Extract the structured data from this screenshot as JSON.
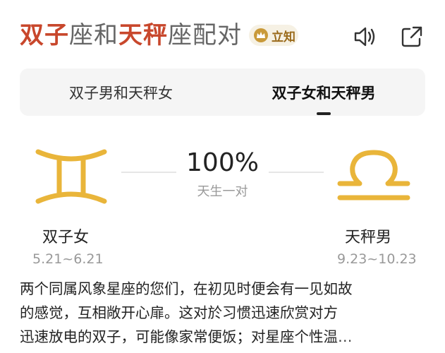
{
  "header": {
    "title": {
      "sign1": "双子",
      "connector1": "座和",
      "sign2": "天秤",
      "suffix": "座配对"
    },
    "badge_label": "立知",
    "speaker_icon": "speaker-icon",
    "share_icon": "share-icon"
  },
  "tabs": [
    {
      "label": "双子男和天秤女",
      "selected": false
    },
    {
      "label": "双子女和天秤男",
      "selected": true
    }
  ],
  "match": {
    "percent": "100%",
    "label": "天生一对",
    "left": {
      "name": "双子女",
      "dates": "5.21~6.21",
      "icon": "gemini-icon"
    },
    "right": {
      "name": "天秤男",
      "dates": "9.23~10.23",
      "icon": "libra-icon"
    }
  },
  "description": {
    "lines": [
      "两个同属风象星座的您们，在初见时便会有一见如故",
      "的感觉，互相敞开心扉。这对於习惯迅速欣赏对方",
      "迅速放电的双子，可能像家常便饭；对星座个性温…"
    ]
  },
  "colors": {
    "accent": "#c8472c",
    "sign_gold": "#e9b53a",
    "badge_bg": "#f6f1e4",
    "badge_text": "#9a6a1a"
  }
}
